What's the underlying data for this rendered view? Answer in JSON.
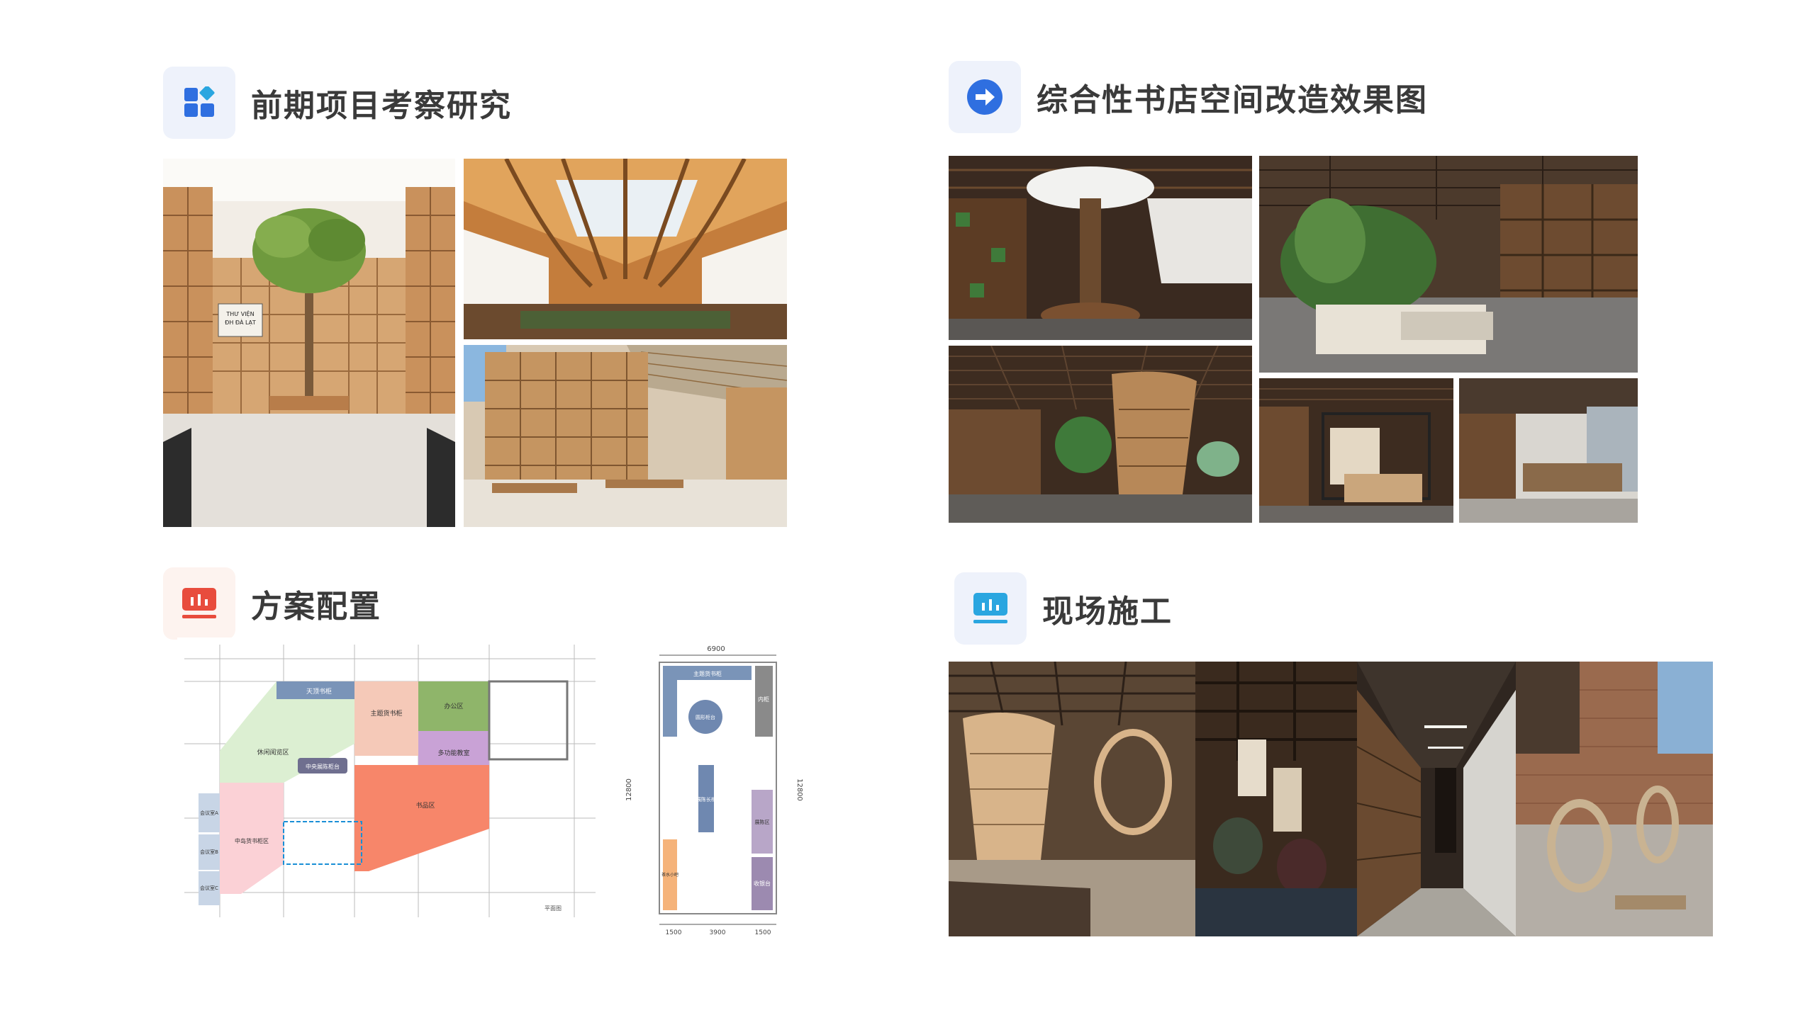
{
  "sections": {
    "research": {
      "title": "前期项目考察研究",
      "icon": "grid-apps-icon"
    },
    "renderings": {
      "title": "综合性书店空间改造效果图",
      "icon": "arrow-right-circle-icon"
    },
    "config": {
      "title": "方案配置",
      "icon": "bar-chart-screen-icon"
    },
    "construction": {
      "title": "现场施工",
      "icon": "bar-chart-monitor-icon"
    }
  },
  "research_photo_sign": {
    "line1": "THƯ VIỆN",
    "line2": "ĐH ĐÀ LẠT"
  },
  "floor_plan_left": {
    "zones": {
      "tiangqing": "天顶书柜",
      "office": "办公区",
      "leisure": "休闲阅览区",
      "main_shelf": "主题货书柜",
      "multi": "多功能教室",
      "center_table": "中央展陈柜台",
      "shop": "书品区",
      "meeting_a": "会议室A",
      "meeting_b": "会议室B",
      "meeting_c": "会议室C",
      "central_shelf": "中岛货书柜区"
    },
    "legend": "平面图"
  },
  "floor_plan_right": {
    "dim_top": "6900",
    "dim_left": "12800",
    "dim_right": "12800",
    "dim_bottom": [
      "1500",
      "3900",
      "1500"
    ],
    "zones": {
      "top_shelf": "主题货书柜",
      "round_table": "圆形柜台",
      "inner": "内柜",
      "long_table": "展陈长柜",
      "side_area": "展陈区",
      "cashier": "收银台",
      "left_strip": "茶水小吧"
    }
  },
  "colors": {
    "accent_blue": "#2f6fe0",
    "accent_red": "#e84c3d",
    "accent_cyan": "#2aa6e0",
    "title": "#3a3a3a"
  }
}
